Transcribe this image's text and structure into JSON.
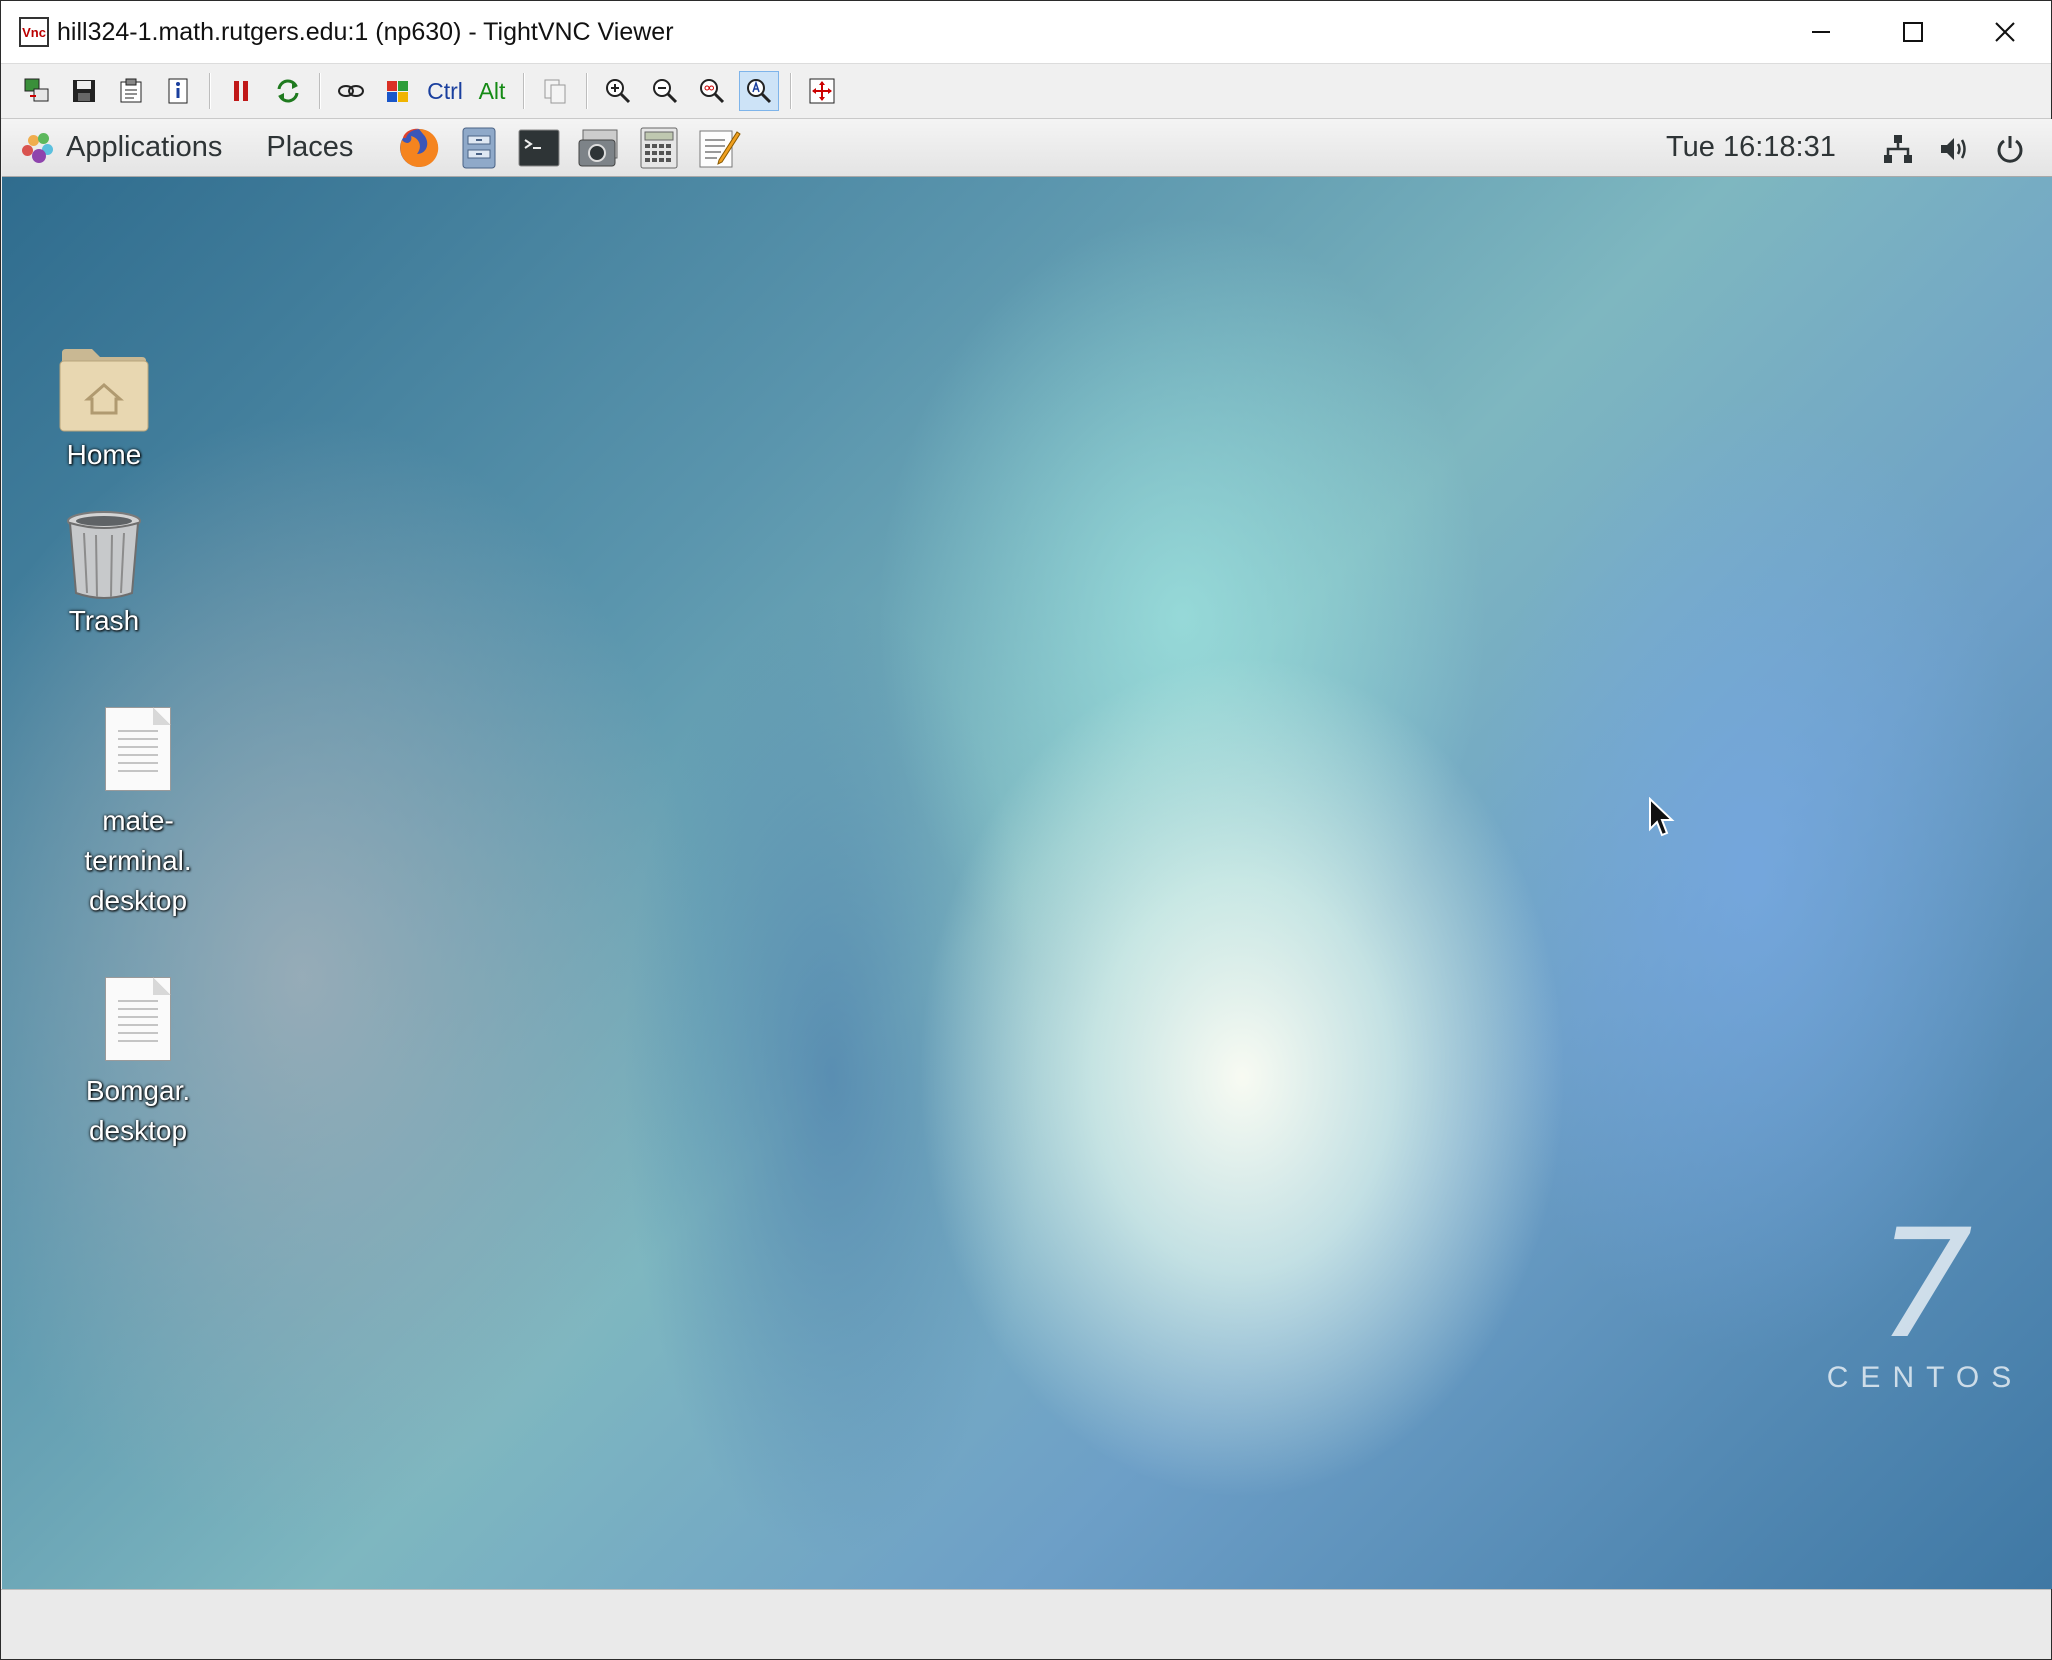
{
  "window": {
    "title": "hill324-1.math.rutgers.edu:1 (np630) - TightVNC Viewer",
    "app_icon_text": "Vnc",
    "controls": {
      "minimize": "—",
      "maximize": "☐",
      "close": "✕"
    }
  },
  "vnc_toolbar": {
    "buttons": [
      {
        "name": "new-connection-icon",
        "glyph": "⎘"
      },
      {
        "name": "save-icon",
        "glyph": "💾"
      },
      {
        "name": "options-icon",
        "glyph": "📋"
      },
      {
        "name": "connection-info-icon",
        "glyph": "ⓘ"
      },
      {
        "name": "pause-icon",
        "glyph": "⏸"
      },
      {
        "name": "refresh-icon",
        "glyph": "⟳"
      },
      {
        "name": "ctrl-alt-del-icon",
        "glyph": "⌨"
      },
      {
        "name": "send-ctrl-esc-icon",
        "glyph": "▦"
      },
      {
        "name": "copy-clipboard-icon",
        "glyph": "⧉"
      },
      {
        "name": "zoom-in-icon",
        "glyph": "⊕"
      },
      {
        "name": "zoom-out-icon",
        "glyph": "⊖"
      },
      {
        "name": "zoom-100-icon",
        "glyph": "⊙"
      },
      {
        "name": "zoom-auto-icon",
        "glyph": "⌕"
      },
      {
        "name": "fullscreen-icon",
        "glyph": "✥"
      }
    ],
    "ctrl_label": "Ctrl",
    "alt_label": "Alt"
  },
  "panel": {
    "applications_label": "Applications",
    "places_label": "Places",
    "launchers": [
      {
        "name": "firefox-icon"
      },
      {
        "name": "file-manager-icon"
      },
      {
        "name": "terminal-icon"
      },
      {
        "name": "screenshot-icon"
      },
      {
        "name": "calculator-icon"
      },
      {
        "name": "text-editor-icon"
      }
    ],
    "clock": "Tue 16:18:31",
    "tray": {
      "network_glyph": "⊞",
      "volume_glyph": "🔊",
      "power_glyph": "⏻"
    }
  },
  "desktop": {
    "icons": [
      {
        "label": "Home",
        "type": "folder"
      },
      {
        "label": "Trash",
        "type": "trash"
      },
      {
        "label_lines": [
          "mate-",
          "terminal.",
          "desktop"
        ],
        "type": "file"
      },
      {
        "label_lines": [
          "Bomgar.",
          "desktop"
        ],
        "type": "file"
      }
    ],
    "logo": {
      "number": "7",
      "word": "CENTOS"
    }
  },
  "colors": {
    "panel_bg": "#e9e9e9",
    "desktop_blue": "#5a95ad",
    "toolbar_bg": "#f0f0f0"
  }
}
